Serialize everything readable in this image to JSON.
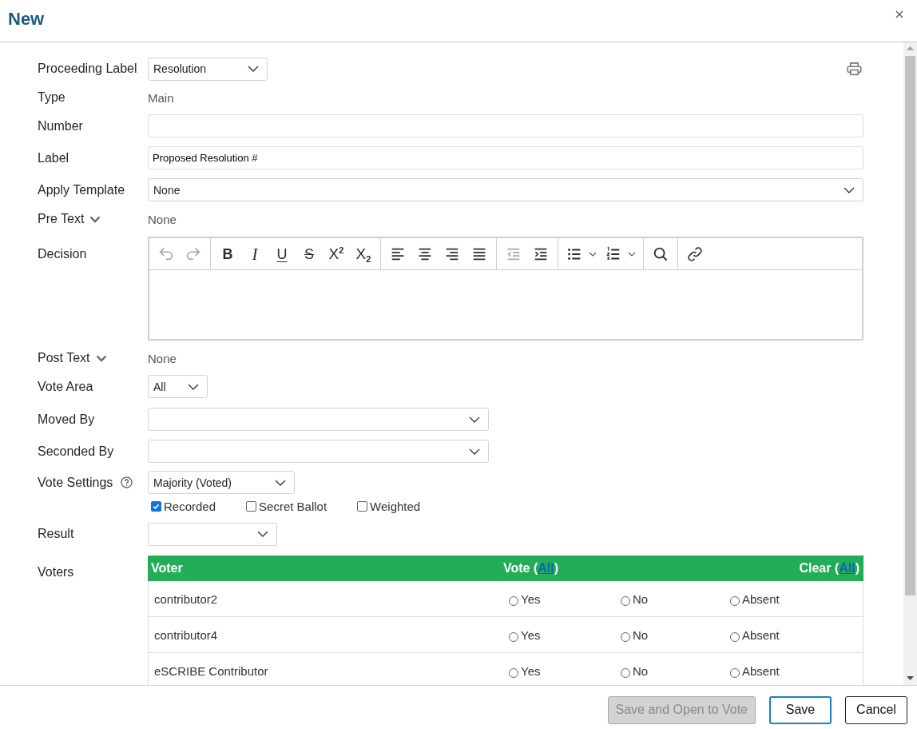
{
  "dialog": {
    "title": "New"
  },
  "form": {
    "proceeding_label": {
      "label": "Proceeding Label",
      "value": "Resolution"
    },
    "type": {
      "label": "Type",
      "value": "Main"
    },
    "number": {
      "label": "Number"
    },
    "label": {
      "label": "Label",
      "value": "Proposed Resolution #"
    },
    "apply_template": {
      "label": "Apply Template",
      "value": "None"
    },
    "pre_text": {
      "label": "Pre Text",
      "expanded": false,
      "value": "None"
    },
    "decision": {
      "label": "Decision",
      "toolbar": {
        "history": [
          {
            "disabled": true
          },
          {
            "disabled": true
          }
        ],
        "format": [
          {
            "kind": "bold",
            "label": "B"
          },
          {
            "kind": "italic",
            "label": "I"
          },
          {
            "kind": "underline",
            "label": "U"
          },
          {
            "kind": "strike",
            "label": "S"
          },
          {
            "kind": "script",
            "label": "X$^{2}$"
          },
          {
            "kind": "script",
            "label": "X$_{2}$"
          }
        ],
        "indent": [
          {
            "disabled": true
          },
          {
            "disabled": false
          }
        ]
      }
    },
    "post_text": {
      "label": "Post Text",
      "expanded": false,
      "value": "None"
    },
    "vote_area": {
      "label": "Vote Area",
      "value": "All"
    },
    "moved_by": {
      "label": "Moved By"
    },
    "seconded_by": {
      "label": "Seconded By"
    },
    "vote_settings": {
      "label": "Vote Settings",
      "value": "Majority (Voted)",
      "options": [
        {
          "label": "Recorded",
          "checked": true
        },
        {
          "label": "Secret Ballot",
          "checked": false
        },
        {
          "label": "Weighted",
          "checked": false
        }
      ]
    },
    "result": {
      "label": "Result"
    },
    "voters": {
      "label": "Voters",
      "columns": {
        "voter": "Voter",
        "vote": {
          "text": "Vote (",
          "link": "All",
          "after": ")"
        },
        "clear": {
          "text": "Clear (",
          "link": "All",
          "after": ")"
        }
      },
      "rows": [
        {
          "name": "contributor2",
          "choices": [
            {
              "label": "Yes",
              "selected": false
            },
            {
              "label": "No",
              "selected": false
            },
            {
              "label": "Absent",
              "selected": false
            }
          ]
        },
        {
          "name": "contributor4",
          "choices": [
            {
              "label": "Yes",
              "selected": false
            },
            {
              "label": "No",
              "selected": false
            },
            {
              "label": "Absent",
              "selected": false
            }
          ]
        },
        {
          "name": "eSCRIBE Contributor",
          "choices": [
            {
              "label": "Yes",
              "selected": false
            },
            {
              "label": "No",
              "selected": false
            },
            {
              "label": "Absent",
              "selected": false
            }
          ]
        }
      ]
    }
  },
  "footer": {
    "buttons": [
      {
        "label": "Save and Open to Vote",
        "disabled": true,
        "primary": false
      },
      {
        "label": "Save",
        "disabled": false,
        "primary": true
      },
      {
        "label": "Cancel",
        "disabled": false,
        "primary": false
      }
    ]
  }
}
